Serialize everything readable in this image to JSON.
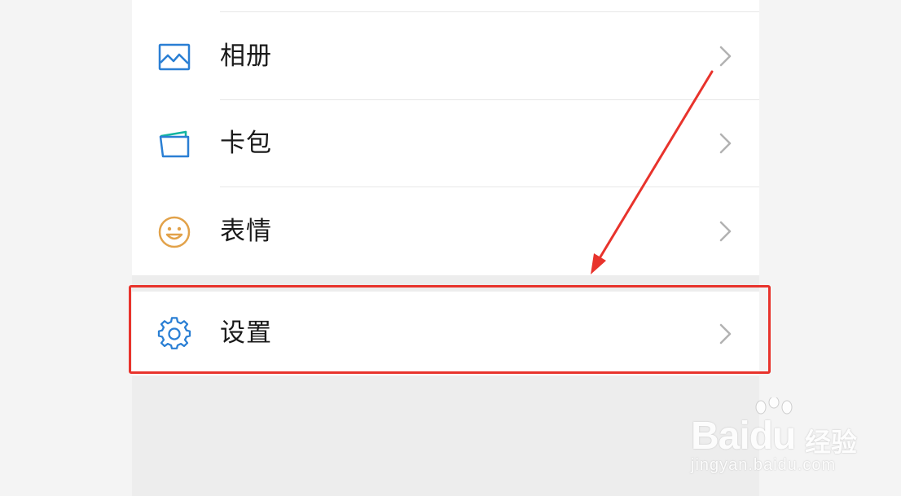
{
  "menu": {
    "items": [
      {
        "label": "相册",
        "icon": "photo-album-icon"
      },
      {
        "label": "卡包",
        "icon": "card-wallet-icon"
      },
      {
        "label": "表情",
        "icon": "smiley-face-icon"
      }
    ],
    "settings": {
      "label": "设置",
      "icon": "gear-icon"
    }
  },
  "colors": {
    "icon_blue": "#2a7fd4",
    "wallet_green": "#12b5a0",
    "smiley_orange": "#e2a24a",
    "highlight_red": "#e8332c",
    "chevron_gray": "#b2b2b2"
  },
  "watermark": {
    "brand": "Bai",
    "brand_mid": "du",
    "brand_cn": "经验",
    "site": "jingyan.baidu.com"
  }
}
